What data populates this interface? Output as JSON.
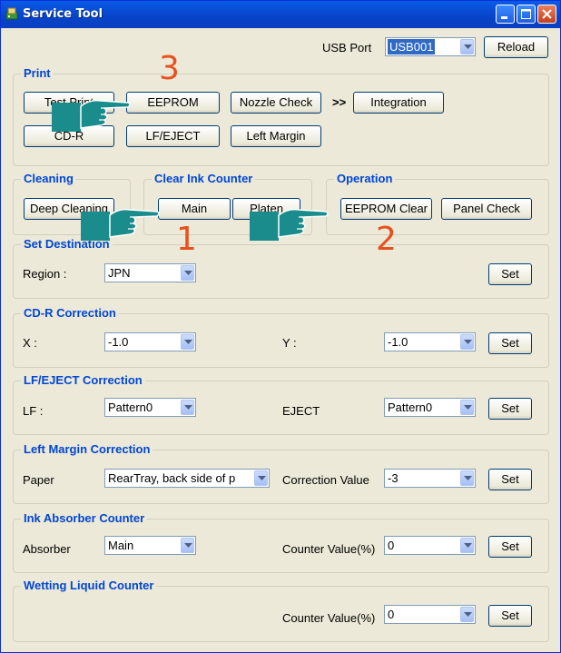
{
  "window": {
    "title": "Service Tool"
  },
  "usb": {
    "label": "USB Port",
    "value": "USB001",
    "reload": "Reload"
  },
  "print": {
    "title": "Print",
    "test_print": "Test Print",
    "eeprom": "EEPROM",
    "nozzle_check": "Nozzle Check",
    "arrows": ">>",
    "integration": "Integration",
    "cd_r": "CD-R",
    "lf_eject": "LF/EJECT",
    "left_margin": "Left Margin"
  },
  "cleaning": {
    "title": "Cleaning",
    "deep": "Deep Cleaning"
  },
  "clear_ink": {
    "title": "Clear Ink Counter",
    "main": "Main",
    "platen": "Platen"
  },
  "operation": {
    "title": "Operation",
    "eeprom_clear": "EEPROM Clear",
    "panel_check": "Panel Check"
  },
  "set_destination": {
    "title": "Set Destination",
    "region_label": "Region :",
    "region_value": "JPN",
    "set": "Set"
  },
  "cdr_correction": {
    "title": "CD-R Correction",
    "x_label": "X :",
    "x_value": "-1.0",
    "y_label": "Y :",
    "y_value": "-1.0",
    "set": "Set"
  },
  "lf_eject_correction": {
    "title": "LF/EJECT Correction",
    "lf_label": "LF :",
    "lf_value": "Pattern0",
    "eject_label": "EJECT",
    "eject_value": "Pattern0",
    "set": "Set"
  },
  "left_margin_correction": {
    "title": "Left Margin Correction",
    "paper_label": "Paper",
    "paper_value": "RearTray, back side of p",
    "corr_label": "Correction Value",
    "corr_value": "-3",
    "set": "Set"
  },
  "ink_absorber": {
    "title": "Ink Absorber Counter",
    "absorber_label": "Absorber",
    "absorber_value": "Main",
    "counter_label": "Counter Value(%)",
    "counter_value": "0",
    "set": "Set"
  },
  "wetting": {
    "title": "Wetting Liquid Counter",
    "counter_label": "Counter Value(%)",
    "counter_value": "0",
    "set": "Set"
  },
  "annotations": {
    "n1": "1",
    "n2": "2",
    "n3": "3"
  },
  "colors": {
    "group_title": "#0046d5",
    "annotation": "#e8501e",
    "hand": "#1a8c8c"
  }
}
